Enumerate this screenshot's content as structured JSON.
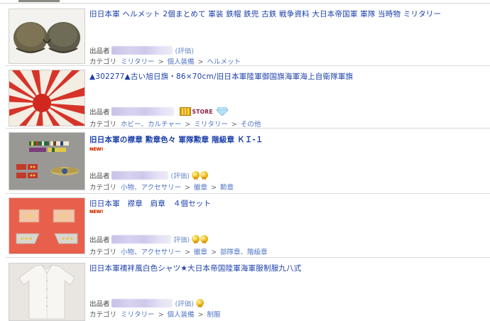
{
  "items": [
    {
      "title": "旧日本軍 ヘルメット 2個まとめて 軍装 鉄帽 鉄兜 古鉄 戦争資料 大日本帝国軍 軍隊 当時物 ミリタリー",
      "new": false,
      "seller_label": "出品者",
      "rating_text": "(評価)",
      "badges": [],
      "category_label": "カテゴリ",
      "category": [
        "ミリタリー",
        "個人装備",
        "ヘルメット"
      ]
    },
    {
      "title": "▲302277▲古い旭日旗・86×70cm/旧日本軍陸軍御国旗海軍海上自衛隊軍旗",
      "new": false,
      "seller_label": "出品者",
      "rating_text": "",
      "badges": [
        "store-badge",
        "diamond-icon"
      ],
      "store_text": "STORE",
      "category_label": "カテゴリ",
      "category": [
        "ホビー、カルチャー",
        "ミリタリー",
        "その他"
      ]
    },
    {
      "title": "旧日本軍の襟章 勲章色々 軍隊勲章 階級章 ＫＩ-１",
      "new": true,
      "new_text": "NEW!",
      "seller_label": "出品者",
      "rating_text": "(評価)",
      "badges": [
        "medal-icon",
        "medal-icon"
      ],
      "category_label": "カテゴリ",
      "category": [
        "小物、アクセサリー",
        "徽章",
        "勲章"
      ]
    },
    {
      "title": "旧日本軍　襟章　肩章　４個セット",
      "new": true,
      "new_text": "NEW!",
      "seller_label": "出品者",
      "rating_text": "評価)",
      "badges": [
        "medal-icon",
        "medal-icon"
      ],
      "category_label": "カテゴリ",
      "category": [
        "小物、アクセサリー",
        "徽章",
        "部隊章、階級章"
      ]
    },
    {
      "title": "旧日本軍襦袢風白色シャツ★大日本帝国陸軍海軍服制服九八式",
      "new": false,
      "seller_label": "出品者",
      "rating_text": "(評価)",
      "badges": [
        "medal-icon"
      ],
      "category_label": "カテゴリ",
      "category": [
        "ミリタリー",
        "個人装備",
        "制服"
      ]
    }
  ],
  "colors": {
    "title_link": "#1a3ea8",
    "category_link": "#4d73c4",
    "separator": "#d9d9d9",
    "new_badge": "#c9191e"
  }
}
